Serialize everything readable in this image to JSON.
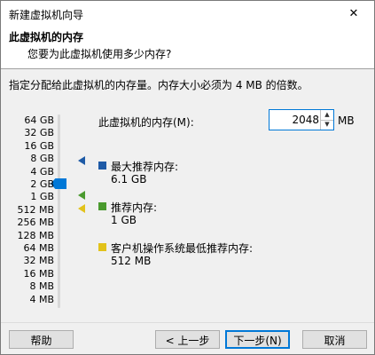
{
  "window": {
    "title": "新建虚拟机向导",
    "close_label": "✕"
  },
  "header": {
    "title": "此虚拟机的内存",
    "subtitle": "您要为此虚拟机使用多少内存?"
  },
  "description": "指定分配给此虚拟机的内存量。内存大小必须为 4 MB 的倍数。",
  "slider": {
    "ticks": [
      "64 GB",
      "32 GB",
      "16 GB",
      "8 GB",
      "4 GB",
      "2 GB",
      "1 GB",
      "512 MB",
      "256 MB",
      "128 MB",
      "64 MB",
      "32 MB",
      "16 MB",
      "8 MB",
      "4 MB"
    ],
    "selected": "2 GB"
  },
  "memory": {
    "label": "此虚拟机的内存(M):",
    "value": "2048",
    "unit": "MB"
  },
  "legend": {
    "max": {
      "label": "最大推荐内存:",
      "value": "6.1 GB",
      "color": "#1e5aa6"
    },
    "recommended": {
      "label": "推荐内存:",
      "value": "1 GB",
      "color": "#4a9a2e"
    },
    "min": {
      "label": "客户机操作系统最低推荐内存:",
      "value": "512 MB",
      "color": "#e2c21a"
    }
  },
  "buttons": {
    "help": "帮助",
    "back": "< 上一步(B)",
    "next": "下一步(N) >",
    "cancel": "取消"
  }
}
